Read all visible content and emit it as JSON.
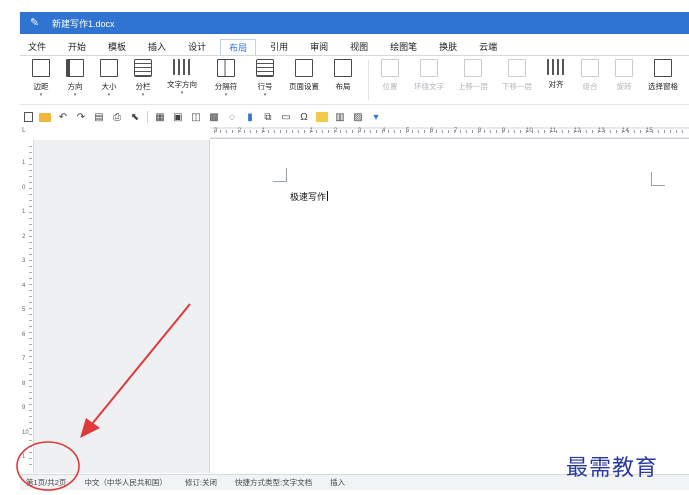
{
  "window": {
    "title": "新建写作1.docx"
  },
  "menu": {
    "tabs": [
      "文件",
      "开始",
      "模板",
      "插入",
      "设计",
      "布局",
      "引用",
      "审阅",
      "视图",
      "绘图笔",
      "换肤",
      "云端"
    ],
    "active_index": 5
  },
  "ribbon": {
    "group1": [
      "边距",
      "方向",
      "大小",
      "分栏",
      "文字方向",
      "分隔符",
      "行号",
      "页面设置",
      "布局"
    ],
    "group2": [
      "位置",
      "环绕文字",
      "上移一层",
      "下移一层",
      "对齐",
      "组合",
      "旋转",
      "选择窗格"
    ]
  },
  "ruler": {
    "h_numbers": [
      "3",
      "2",
      "1",
      "1",
      "2",
      "3",
      "4",
      "5",
      "6",
      "7",
      "8",
      "9",
      "10",
      "11",
      "12",
      "13",
      "14",
      "15"
    ],
    "v_numbers": [
      "1",
      "0",
      "1",
      "2",
      "3",
      "4",
      "5",
      "6",
      "7",
      "8",
      "9",
      "10",
      "1"
    ],
    "corner": "L"
  },
  "document": {
    "text": "极速写作"
  },
  "status": {
    "page": "第1页/共2页",
    "language": "中文（中华人民共和国）",
    "track_changes": "修订:关闭",
    "shortcut_type": "快捷方式类型:文字文档",
    "mode": "插入"
  },
  "watermark": "最需教育",
  "colors": {
    "title_bar": "#2f74d0",
    "annotation": "#e03a3a",
    "watermark": "#2a3a9a"
  }
}
